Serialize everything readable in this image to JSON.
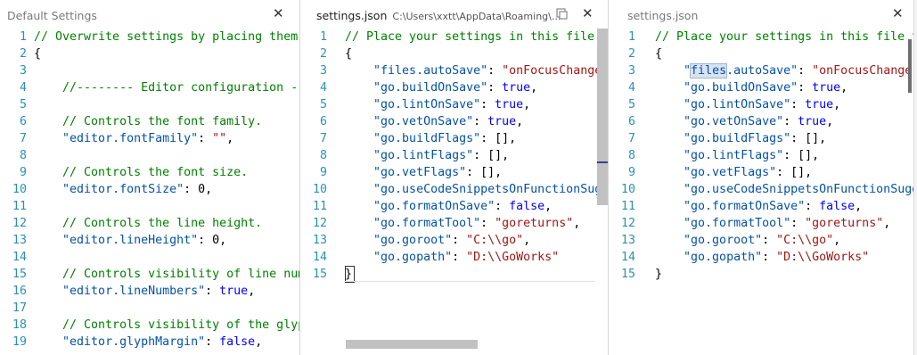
{
  "panes": [
    {
      "title": "Default Settings",
      "title_color": "#7a7a7a",
      "lines": [
        {
          "n": "1",
          "t": [
            {
              "c": "cmt",
              "v": "// Overwrite settings by placing them i"
            }
          ]
        },
        {
          "n": "2",
          "t": [
            {
              "c": "",
              "v": "{"
            }
          ]
        },
        {
          "n": "3",
          "t": []
        },
        {
          "n": "4",
          "t": [
            {
              "c": "cmt",
              "v": "    //-------- Editor configuration ---"
            }
          ]
        },
        {
          "n": "5",
          "t": []
        },
        {
          "n": "6",
          "t": [
            {
              "c": "cmt",
              "v": "    // Controls the font family."
            }
          ]
        },
        {
          "n": "7",
          "t": [
            {
              "c": "",
              "v": "    "
            },
            {
              "c": "key",
              "v": "\"editor.fontFamily\""
            },
            {
              "c": "",
              "v": ": "
            },
            {
              "c": "str",
              "v": "\"\""
            },
            {
              "c": "",
              "v": ","
            }
          ]
        },
        {
          "n": "8",
          "t": []
        },
        {
          "n": "9",
          "t": [
            {
              "c": "cmt",
              "v": "    // Controls the font size."
            }
          ]
        },
        {
          "n": "10",
          "t": [
            {
              "c": "",
              "v": "    "
            },
            {
              "c": "key",
              "v": "\"editor.fontSize\""
            },
            {
              "c": "",
              "v": ": 0,"
            }
          ]
        },
        {
          "n": "11",
          "t": []
        },
        {
          "n": "12",
          "t": [
            {
              "c": "cmt",
              "v": "    // Controls the line height."
            }
          ]
        },
        {
          "n": "13",
          "t": [
            {
              "c": "",
              "v": "    "
            },
            {
              "c": "key",
              "v": "\"editor.lineHeight\""
            },
            {
              "c": "",
              "v": ": 0,"
            }
          ]
        },
        {
          "n": "14",
          "t": []
        },
        {
          "n": "15",
          "t": [
            {
              "c": "cmt",
              "v": "    // Controls visibility of line numb"
            }
          ]
        },
        {
          "n": "16",
          "t": [
            {
              "c": "",
              "v": "    "
            },
            {
              "c": "key",
              "v": "\"editor.lineNumbers\""
            },
            {
              "c": "",
              "v": ": "
            },
            {
              "c": "kw",
              "v": "true"
            },
            {
              "c": "",
              "v": ","
            }
          ]
        },
        {
          "n": "17",
          "t": []
        },
        {
          "n": "18",
          "t": [
            {
              "c": "cmt",
              "v": "    // Controls visibility of the glyph"
            }
          ]
        },
        {
          "n": "19",
          "t": [
            {
              "c": "",
              "v": "    "
            },
            {
              "c": "key",
              "v": "\"editor.glyphMargin\""
            },
            {
              "c": "",
              "v": ": "
            },
            {
              "c": "kw",
              "v": "false"
            },
            {
              "c": "",
              "v": ","
            }
          ]
        }
      ]
    },
    {
      "title": "settings.json",
      "title_color": "#222222",
      "path": "C:\\Users\\xxtt\\AppData\\Roaming\\...",
      "lines": [
        {
          "n": "1",
          "t": [
            {
              "c": "cmt",
              "v": "// Place your settings in this file to"
            }
          ]
        },
        {
          "n": "2",
          "t": [
            {
              "c": "",
              "v": "{"
            }
          ]
        },
        {
          "n": "3",
          "t": [
            {
              "c": "",
              "v": "    "
            },
            {
              "c": "key",
              "v": "\"files.autoSave\""
            },
            {
              "c": "",
              "v": ": "
            },
            {
              "c": "str",
              "v": "\"onFocusChange\""
            },
            {
              "c": "",
              "v": ","
            }
          ]
        },
        {
          "n": "4",
          "t": [
            {
              "c": "",
              "v": "    "
            },
            {
              "c": "key",
              "v": "\"go.buildOnSave\""
            },
            {
              "c": "",
              "v": ": "
            },
            {
              "c": "kw",
              "v": "true"
            },
            {
              "c": "",
              "v": ","
            }
          ]
        },
        {
          "n": "5",
          "t": [
            {
              "c": "",
              "v": "    "
            },
            {
              "c": "key",
              "v": "\"go.lintOnSave\""
            },
            {
              "c": "",
              "v": ": "
            },
            {
              "c": "kw",
              "v": "true"
            },
            {
              "c": "",
              "v": ","
            }
          ]
        },
        {
          "n": "6",
          "t": [
            {
              "c": "",
              "v": "    "
            },
            {
              "c": "key",
              "v": "\"go.vetOnSave\""
            },
            {
              "c": "",
              "v": ": "
            },
            {
              "c": "kw",
              "v": "true"
            },
            {
              "c": "",
              "v": ","
            }
          ]
        },
        {
          "n": "7",
          "t": [
            {
              "c": "",
              "v": "    "
            },
            {
              "c": "key",
              "v": "\"go.buildFlags\""
            },
            {
              "c": "",
              "v": ": [],"
            }
          ]
        },
        {
          "n": "8",
          "t": [
            {
              "c": "",
              "v": "    "
            },
            {
              "c": "key",
              "v": "\"go.lintFlags\""
            },
            {
              "c": "",
              "v": ": [],"
            }
          ]
        },
        {
          "n": "9",
          "t": [
            {
              "c": "",
              "v": "    "
            },
            {
              "c": "key",
              "v": "\"go.vetFlags\""
            },
            {
              "c": "",
              "v": ": [],"
            }
          ]
        },
        {
          "n": "10",
          "t": [
            {
              "c": "",
              "v": "    "
            },
            {
              "c": "key",
              "v": "\"go.useCodeSnippetsOnFunctionSugge"
            }
          ]
        },
        {
          "n": "11",
          "t": [
            {
              "c": "",
              "v": "    "
            },
            {
              "c": "key",
              "v": "\"go.formatOnSave\""
            },
            {
              "c": "",
              "v": ": "
            },
            {
              "c": "kw",
              "v": "false"
            },
            {
              "c": "",
              "v": ","
            }
          ]
        },
        {
          "n": "12",
          "t": [
            {
              "c": "",
              "v": "    "
            },
            {
              "c": "key",
              "v": "\"go.formatTool\""
            },
            {
              "c": "",
              "v": ": "
            },
            {
              "c": "str",
              "v": "\"goreturns\""
            },
            {
              "c": "",
              "v": ","
            }
          ]
        },
        {
          "n": "13",
          "t": [
            {
              "c": "",
              "v": "    "
            },
            {
              "c": "key",
              "v": "\"go.goroot\""
            },
            {
              "c": "",
              "v": ": "
            },
            {
              "c": "str",
              "v": "\"C:\\\\go\""
            },
            {
              "c": "",
              "v": ","
            }
          ]
        },
        {
          "n": "14",
          "t": [
            {
              "c": "",
              "v": "    "
            },
            {
              "c": "key",
              "v": "\"go.gopath\""
            },
            {
              "c": "",
              "v": ": "
            },
            {
              "c": "str",
              "v": "\"D:\\\\GoWorks\""
            }
          ]
        },
        {
          "n": "15",
          "t": [
            {
              "c": "",
              "v": "}"
            }
          ]
        }
      ]
    },
    {
      "title": "settings.json",
      "title_color": "#7a7a7a",
      "lines": [
        {
          "n": "1",
          "t": [
            {
              "c": "cmt",
              "v": "// Place your settings in this file to"
            }
          ]
        },
        {
          "n": "2",
          "t": [
            {
              "c": "",
              "v": "{"
            }
          ]
        },
        {
          "n": "3",
          "t": [
            {
              "c": "",
              "v": "    "
            },
            {
              "c": "key",
              "v": "\""
            },
            {
              "c": "key hl",
              "v": "files"
            },
            {
              "c": "key",
              "v": ".autoSave\""
            },
            {
              "c": "",
              "v": ": "
            },
            {
              "c": "str",
              "v": "\"onFocusChange\""
            },
            {
              "c": "",
              "v": ","
            }
          ]
        },
        {
          "n": "4",
          "t": [
            {
              "c": "",
              "v": "    "
            },
            {
              "c": "key",
              "v": "\"go.buildOnSave\""
            },
            {
              "c": "",
              "v": ": "
            },
            {
              "c": "kw",
              "v": "true"
            },
            {
              "c": "",
              "v": ","
            }
          ]
        },
        {
          "n": "5",
          "t": [
            {
              "c": "",
              "v": "    "
            },
            {
              "c": "key",
              "v": "\"go.lintOnSave\""
            },
            {
              "c": "",
              "v": ": "
            },
            {
              "c": "kw",
              "v": "true"
            },
            {
              "c": "",
              "v": ","
            }
          ]
        },
        {
          "n": "6",
          "t": [
            {
              "c": "",
              "v": "    "
            },
            {
              "c": "key",
              "v": "\"go.vetOnSave\""
            },
            {
              "c": "",
              "v": ": "
            },
            {
              "c": "kw",
              "v": "true"
            },
            {
              "c": "",
              "v": ","
            }
          ]
        },
        {
          "n": "7",
          "t": [
            {
              "c": "",
              "v": "    "
            },
            {
              "c": "key",
              "v": "\"go.buildFlags\""
            },
            {
              "c": "",
              "v": ": [],"
            }
          ]
        },
        {
          "n": "8",
          "t": [
            {
              "c": "",
              "v": "    "
            },
            {
              "c": "key",
              "v": "\"go.lintFlags\""
            },
            {
              "c": "",
              "v": ": [],"
            }
          ]
        },
        {
          "n": "9",
          "t": [
            {
              "c": "",
              "v": "    "
            },
            {
              "c": "key",
              "v": "\"go.vetFlags\""
            },
            {
              "c": "",
              "v": ": [],"
            }
          ]
        },
        {
          "n": "10",
          "t": [
            {
              "c": "",
              "v": "    "
            },
            {
              "c": "key",
              "v": "\"go.useCodeSnippetsOnFunctionSugge"
            }
          ]
        },
        {
          "n": "11",
          "t": [
            {
              "c": "",
              "v": "    "
            },
            {
              "c": "key",
              "v": "\"go.formatOnSave\""
            },
            {
              "c": "",
              "v": ": "
            },
            {
              "c": "kw",
              "v": "false"
            },
            {
              "c": "",
              "v": ","
            }
          ]
        },
        {
          "n": "12",
          "t": [
            {
              "c": "",
              "v": "    "
            },
            {
              "c": "key",
              "v": "\"go.formatTool\""
            },
            {
              "c": "",
              "v": ": "
            },
            {
              "c": "str",
              "v": "\"goreturns\""
            },
            {
              "c": "",
              "v": ","
            }
          ]
        },
        {
          "n": "13",
          "t": [
            {
              "c": "",
              "v": "    "
            },
            {
              "c": "key",
              "v": "\"go.goroot\""
            },
            {
              "c": "",
              "v": ": "
            },
            {
              "c": "str",
              "v": "\"C:\\\\go\""
            },
            {
              "c": "",
              "v": ","
            }
          ]
        },
        {
          "n": "14",
          "t": [
            {
              "c": "",
              "v": "    "
            },
            {
              "c": "key",
              "v": "\"go.gopath\""
            },
            {
              "c": "",
              "v": ": "
            },
            {
              "c": "str",
              "v": "\"D:\\\\GoWorks\""
            }
          ]
        },
        {
          "n": "15",
          "t": [
            {
              "c": "",
              "v": "}"
            }
          ]
        }
      ]
    }
  ],
  "close_glyph": "✕",
  "icons": {
    "close": "close-icon",
    "split": "split-editor-icon"
  },
  "colors": {
    "line_number": "#2b91af",
    "comment": "#008000",
    "key": "#0451a5",
    "string": "#a31515",
    "keyword": "#0000ff"
  }
}
